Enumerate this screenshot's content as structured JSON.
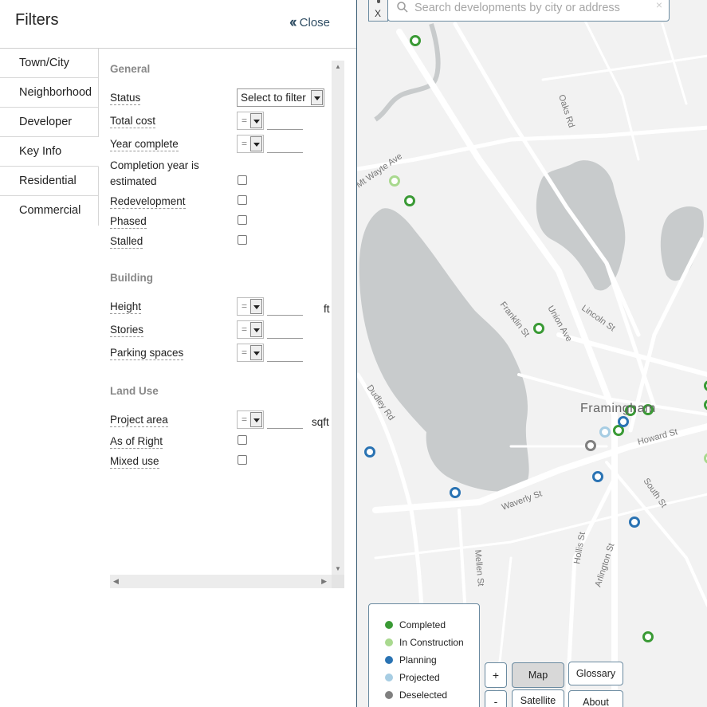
{
  "panel": {
    "title": "Filters",
    "close_label": "Close",
    "tabs": [
      {
        "label": "Town/City"
      },
      {
        "label": "Neighborhood"
      },
      {
        "label": "Developer"
      },
      {
        "label": "Key Info",
        "active": true
      },
      {
        "label": "Residential"
      },
      {
        "label": "Commercial"
      }
    ]
  },
  "filters": {
    "general": {
      "heading": "General",
      "status_label": "Status",
      "status_value": "Select to filter",
      "total_cost_label": "Total cost",
      "total_cost_op": "=",
      "year_complete_label": "Year complete",
      "year_complete_op": "=",
      "completion_estimated_label_1": "Completion year is",
      "completion_estimated_label_2": "estimated",
      "redevelopment_label": "Redevelopment",
      "phased_label": "Phased",
      "stalled_label": "Stalled"
    },
    "building": {
      "heading": "Building",
      "height_label": "Height",
      "height_op": "=",
      "height_unit": "ft",
      "stories_label": "Stories",
      "stories_op": "=",
      "parking_label": "Parking spaces",
      "parking_op": "="
    },
    "land_use": {
      "heading": "Land Use",
      "project_area_label": "Project area",
      "project_area_op": "=",
      "project_area_unit": "sqft",
      "as_of_right_label": "As of Right",
      "mixed_use_label": "Mixed use"
    }
  },
  "map": {
    "search_placeholder": "Search developments by city or address",
    "search_clear": "×",
    "x_button": "X",
    "city_label": "Framingham",
    "streets": {
      "oaks_rd": "Oaks Rd",
      "mt_wayte": "Mt Wayte Ave",
      "franklin": "Franklin St",
      "union": "Union Ave",
      "lincoln": "Lincoln St",
      "dudley": "Dudley Rd",
      "howard": "Howard St",
      "south": "South St",
      "waverly": "Waverly St",
      "hollis": "Hollis St",
      "arlington": "Arlington St",
      "mellen": "Mellen St"
    },
    "legend": [
      {
        "label": "Completed",
        "color": "#3a9a35"
      },
      {
        "label": "In Construction",
        "color": "#a9d98f"
      },
      {
        "label": "Planning",
        "color": "#2a73b3"
      },
      {
        "label": "Projected",
        "color": "#a7cde3"
      },
      {
        "label": "Deselected",
        "color": "#808080"
      }
    ],
    "zoom_in": "+",
    "zoom_out": "-",
    "map_button": "Map",
    "satellite_button": "Satellite",
    "glossary_button": "Glossary",
    "about_button": "About"
  }
}
